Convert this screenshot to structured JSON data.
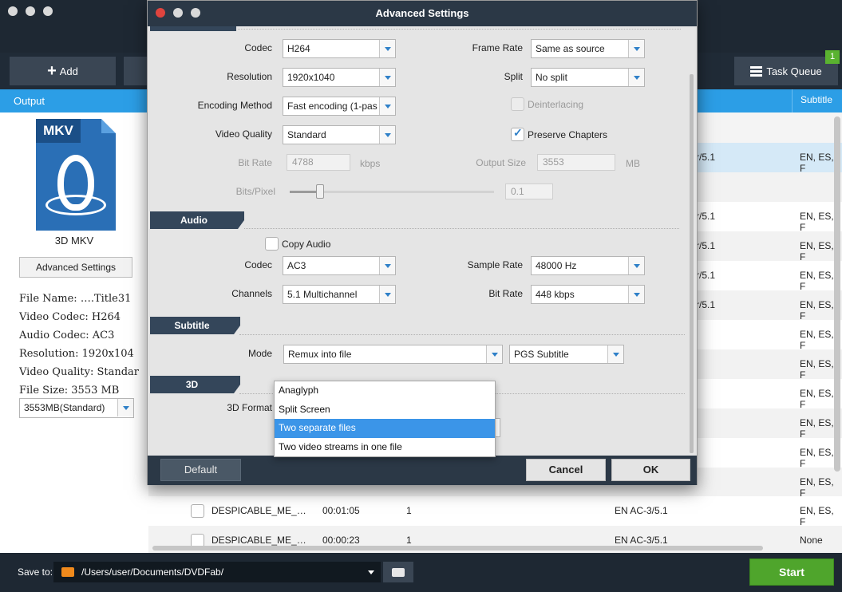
{
  "main": {
    "toolbar": {
      "add_label": "Add",
      "task_queue_label": "Task Queue",
      "queue_badge": "1"
    },
    "output_label": "Output",
    "subtitle_header": "Subtitle",
    "profile": {
      "format_badge": "MKV",
      "name": "3D MKV",
      "advanced_button": "Advanced Settings"
    },
    "info": [
      "File Name: ….Title31",
      "Video Codec: H264",
      "Audio Codec: AC3",
      "Resolution: 1920x104",
      "Video Quality: Standar",
      "File Size: 3553 MB"
    ],
    "size_select": "3553MB(Standard)",
    "right_rows": [
      {
        "audio": "r/5.1",
        "subs": "EN, ES, F",
        "highlight": true
      },
      {
        "audio": "",
        "subs": "",
        "highlight": false
      },
      {
        "audio": "r/5.1",
        "subs": "EN, ES, F",
        "highlight": false
      },
      {
        "audio": "r/5.1",
        "subs": "EN, ES, F",
        "highlight": false
      },
      {
        "audio": "r/5.1",
        "subs": "EN, ES, F",
        "highlight": false
      },
      {
        "audio": "r/5.1",
        "subs": "EN, ES, F",
        "highlight": false
      },
      {
        "audio": "",
        "subs": "EN, ES, F",
        "highlight": false
      },
      {
        "audio": "",
        "subs": "EN, ES, F",
        "highlight": false
      },
      {
        "audio": "",
        "subs": "EN, ES, F",
        "highlight": false
      },
      {
        "audio": "",
        "subs": "EN, ES, F",
        "highlight": false
      },
      {
        "audio": "",
        "subs": "EN, ES, F",
        "highlight": false
      },
      {
        "audio": "",
        "subs": "EN, ES, F",
        "highlight": false
      }
    ],
    "title_rows": [
      {
        "name": "DESPICABLE_ME_…",
        "duration": "00:01:05",
        "chapters": "1",
        "audio": "EN  AC-3/5.1",
        "subs": "EN, ES, F"
      },
      {
        "name": "DESPICABLE_ME_…",
        "duration": "00:00:23",
        "chapters": "1",
        "audio": "EN  AC-3/5.1",
        "subs": "None"
      }
    ],
    "footer": {
      "save_to_label": "Save to:",
      "save_path": "/Users/user/Documents/DVDFab/",
      "start_label": "Start"
    }
  },
  "dialog": {
    "title": "Advanced Settings",
    "video": {
      "codec_label": "Codec",
      "codec_value": "H264",
      "resolution_label": "Resolution",
      "resolution_value": "1920x1040",
      "encoding_label": "Encoding Method",
      "encoding_value": "Fast encoding (1-pas",
      "quality_label": "Video Quality",
      "quality_value": "Standard",
      "bitrate_label": "Bit Rate",
      "bitrate_value": "4788",
      "bitrate_unit": "kbps",
      "bitspixel_label": "Bits/Pixel",
      "bitspixel_value": "0.1",
      "bitspixel_slider": 0.15,
      "framerate_label": "Frame Rate",
      "framerate_value": "Same as source",
      "split_label": "Split",
      "split_value": "No split",
      "deinterlacing_label": "Deinterlacing",
      "preserve_chapters_label": "Preserve Chapters",
      "outsize_label": "Output Size",
      "outsize_value": "3553",
      "outsize_unit": "MB"
    },
    "audio": {
      "section": "Audio",
      "copy_audio_label": "Copy Audio",
      "codec_label": "Codec",
      "codec_value": "AC3",
      "channels_label": "Channels",
      "channels_value": "5.1 Multichannel",
      "samplerate_label": "Sample Rate",
      "samplerate_value": "48000 Hz",
      "bitrate_label": "Bit Rate",
      "bitrate_value": "448 kbps"
    },
    "subtitle": {
      "section": "Subtitle",
      "mode_label": "Mode",
      "mode_value": "Remux into file",
      "type_value": "PGS Subtitle"
    },
    "threed": {
      "section": "3D",
      "format_label": "3D Format",
      "options": [
        "Anaglyph",
        "Split Screen",
        "Two separate files",
        "Two video streams in one file"
      ],
      "selected_index": 2
    },
    "buttons": {
      "default": "Default",
      "cancel": "Cancel",
      "ok": "OK"
    }
  }
}
